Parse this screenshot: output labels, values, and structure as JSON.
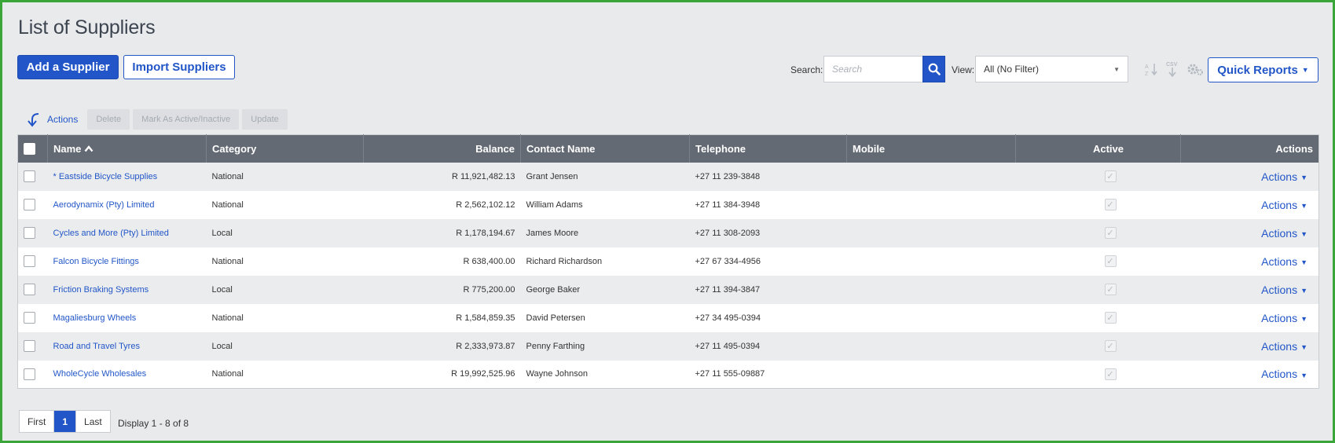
{
  "page": {
    "title": "List of Suppliers"
  },
  "toolbar": {
    "add_label": "Add a Supplier",
    "import_label": "Import Suppliers",
    "search_label": "Search:",
    "search_placeholder": "Search",
    "view_label": "View:",
    "view_value": "All (No Filter)",
    "quick_reports_label": "Quick Reports",
    "icons": [
      "sort-az-icon",
      "csv-download-icon",
      "settings-gears-icon"
    ]
  },
  "actions_bar": {
    "label": "Actions",
    "delete_label": "Delete",
    "mark_label": "Mark As Active/Inactive",
    "update_label": "Update"
  },
  "table": {
    "columns": {
      "name": "Name",
      "category": "Category",
      "balance": "Balance",
      "contact": "Contact Name",
      "telephone": "Telephone",
      "mobile": "Mobile",
      "active": "Active",
      "actions": "Actions"
    },
    "rows": [
      {
        "name": "* Eastside Bicycle Supplies",
        "category": "National",
        "balance": "R 11,921,482.13",
        "contact": "Grant Jensen",
        "telephone": "+27 11 239-3848",
        "mobile": "",
        "actions": "Actions"
      },
      {
        "name": "Aerodynamix (Pty) Limited",
        "category": "National",
        "balance": "R 2,562,102.12",
        "contact": "William Adams",
        "telephone": "+27 11 384-3948",
        "mobile": "",
        "actions": "Actions"
      },
      {
        "name": "Cycles and More (Pty) Limited",
        "category": "Local",
        "balance": "R 1,178,194.67",
        "contact": "James Moore",
        "telephone": "+27 11 308-2093",
        "mobile": "",
        "actions": "Actions"
      },
      {
        "name": "Falcon Bicycle Fittings",
        "category": "National",
        "balance": "R 638,400.00",
        "contact": "Richard Richardson",
        "telephone": "+27 67 334-4956",
        "mobile": "",
        "actions": "Actions"
      },
      {
        "name": "Friction Braking Systems",
        "category": "Local",
        "balance": "R 775,200.00",
        "contact": "George Baker",
        "telephone": "+27 11 394-3847",
        "mobile": "",
        "actions": "Actions"
      },
      {
        "name": "Magaliesburg Wheels",
        "category": "National",
        "balance": "R 1,584,859.35",
        "contact": "David Petersen",
        "telephone": "+27 34 495-0394",
        "mobile": "",
        "actions": "Actions"
      },
      {
        "name": "Road and Travel Tyres",
        "category": "Local",
        "balance": "R 2,333,973.87",
        "contact": "Penny Farthing",
        "telephone": "+27 11 495-0394",
        "mobile": "",
        "actions": "Actions"
      },
      {
        "name": "WholeCycle Wholesales",
        "category": "National",
        "balance": "R 19,992,525.96",
        "contact": "Wayne Johnson",
        "telephone": "+27 11 555-09887",
        "mobile": "",
        "actions": "Actions"
      }
    ]
  },
  "pager": {
    "first_label": "First",
    "current_page": "1",
    "last_label": "Last",
    "info": "Display 1 - 8 of 8"
  },
  "colors": {
    "accent": "#2256c8",
    "header_bg": "#646a74",
    "frame": "#3aa63a"
  }
}
